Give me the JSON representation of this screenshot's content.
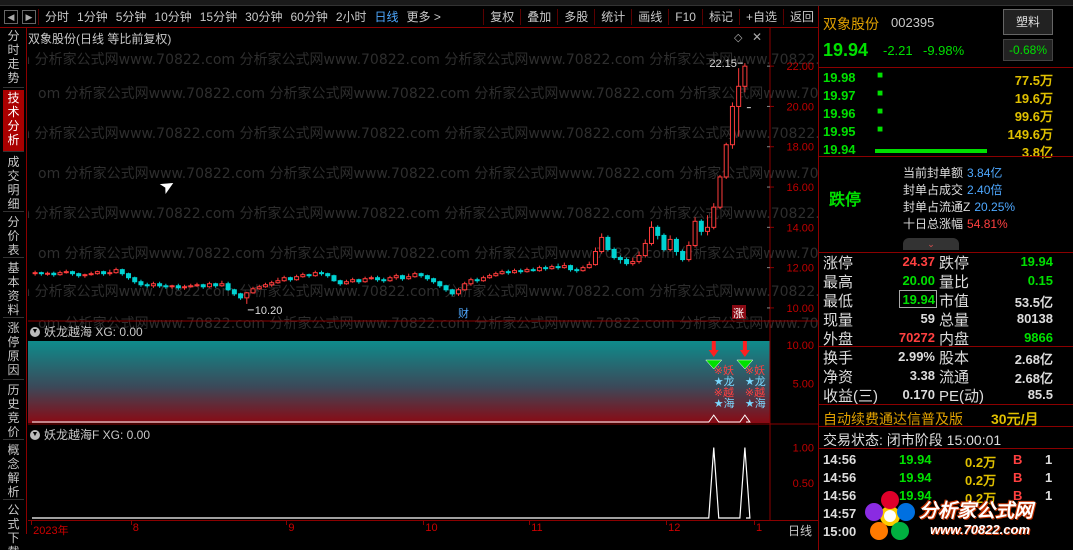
{
  "toolbar": {
    "periods": [
      "分时",
      "1分钟",
      "5分钟",
      "10分钟",
      "15分钟",
      "30分钟",
      "60分钟",
      "2小时",
      "日线",
      "更多 >"
    ],
    "active_period": "日线",
    "actions": [
      "复权",
      "叠加",
      "多股",
      "统计",
      "画线",
      "F10",
      "标记",
      "+自选",
      "返回"
    ]
  },
  "left_tabs": [
    "分时走势",
    "技术分析",
    "成交明细",
    "分价表",
    "基本资料",
    "涨停原因",
    "历史竞价",
    "概念解析",
    "公式下载"
  ],
  "left_tab_active": "技术分析",
  "main_chart": {
    "title": "双象股份(日线 等比前复权)",
    "y_ticks": [
      "22.00",
      "20.00",
      "18.00",
      "16.00",
      "14.00",
      "12.00",
      "10.00"
    ],
    "y_range": [
      9.5,
      23.0
    ],
    "high_label": "22.15",
    "low_label": "10.20",
    "marker_cai": "财",
    "marker_zhang": "涨",
    "watermark": "om 分析家公式网www.70822.com 分析家公式网www.70822.com 分析家公式网www.70822.com 分析家公式网www.70822.com",
    "candles": [
      [
        11.7,
        11.75,
        11.6,
        11.85
      ],
      [
        11.75,
        11.7,
        11.6,
        11.8
      ],
      [
        11.7,
        11.72,
        11.6,
        11.8
      ],
      [
        11.72,
        11.65,
        11.55,
        11.8
      ],
      [
        11.65,
        11.75,
        11.6,
        11.85
      ],
      [
        11.75,
        11.8,
        11.7,
        11.9
      ],
      [
        11.8,
        11.7,
        11.6,
        11.85
      ],
      [
        11.7,
        11.6,
        11.5,
        11.75
      ],
      [
        11.6,
        11.65,
        11.5,
        11.7
      ],
      [
        11.65,
        11.7,
        11.6,
        11.8
      ],
      [
        11.7,
        11.8,
        11.65,
        11.85
      ],
      [
        11.8,
        11.7,
        11.6,
        11.85
      ],
      [
        11.7,
        11.75,
        11.6,
        11.9
      ],
      [
        11.75,
        11.9,
        11.7,
        12.0
      ],
      [
        11.9,
        11.7,
        11.6,
        11.95
      ],
      [
        11.7,
        11.5,
        11.4,
        11.75
      ],
      [
        11.5,
        11.3,
        11.2,
        11.55
      ],
      [
        11.3,
        11.15,
        11.05,
        11.4
      ],
      [
        11.15,
        11.1,
        11.0,
        11.25
      ],
      [
        11.1,
        11.2,
        11.0,
        11.3
      ],
      [
        11.2,
        11.1,
        11.0,
        11.3
      ],
      [
        11.1,
        11.05,
        10.95,
        11.2
      ],
      [
        11.05,
        11.1,
        10.95,
        11.15
      ],
      [
        11.1,
        11.0,
        10.9,
        11.2
      ],
      [
        11.0,
        11.05,
        10.9,
        11.15
      ],
      [
        11.05,
        11.1,
        11.0,
        11.2
      ],
      [
        11.1,
        11.15,
        11.05,
        11.25
      ],
      [
        11.15,
        11.05,
        10.95,
        11.2
      ],
      [
        11.05,
        11.2,
        11.0,
        11.3
      ],
      [
        11.2,
        11.1,
        11.0,
        11.25
      ],
      [
        11.1,
        11.2,
        11.05,
        11.35
      ],
      [
        11.2,
        10.9,
        10.85,
        11.3
      ],
      [
        10.9,
        10.7,
        10.6,
        10.95
      ],
      [
        10.7,
        10.5,
        10.4,
        10.75
      ],
      [
        10.5,
        10.75,
        10.2,
        10.8
      ],
      [
        10.75,
        10.95,
        10.7,
        11.05
      ],
      [
        10.95,
        11.05,
        10.9,
        11.15
      ],
      [
        11.05,
        11.15,
        11.0,
        11.25
      ],
      [
        11.15,
        11.25,
        11.05,
        11.35
      ],
      [
        11.25,
        11.35,
        11.2,
        11.5
      ],
      [
        11.35,
        11.5,
        11.3,
        11.6
      ],
      [
        11.5,
        11.4,
        11.3,
        11.55
      ],
      [
        11.4,
        11.55,
        11.35,
        11.65
      ],
      [
        11.55,
        11.65,
        11.5,
        11.75
      ],
      [
        11.65,
        11.6,
        11.5,
        11.7
      ],
      [
        11.6,
        11.75,
        11.55,
        11.85
      ],
      [
        11.75,
        11.7,
        11.6,
        11.85
      ],
      [
        11.7,
        11.6,
        11.5,
        11.75
      ],
      [
        11.6,
        11.35,
        11.3,
        11.65
      ],
      [
        11.35,
        11.2,
        11.1,
        11.4
      ],
      [
        11.2,
        11.3,
        11.15,
        11.4
      ],
      [
        11.3,
        11.4,
        11.25,
        11.5
      ],
      [
        11.4,
        11.3,
        11.2,
        11.45
      ],
      [
        11.3,
        11.45,
        11.25,
        11.55
      ],
      [
        11.45,
        11.5,
        11.4,
        11.6
      ],
      [
        11.5,
        11.4,
        11.3,
        11.6
      ],
      [
        11.4,
        11.35,
        11.25,
        11.5
      ],
      [
        11.35,
        11.5,
        11.3,
        11.6
      ],
      [
        11.5,
        11.6,
        11.4,
        11.7
      ],
      [
        11.6,
        11.45,
        11.35,
        11.65
      ],
      [
        11.45,
        11.55,
        11.4,
        11.7
      ],
      [
        11.55,
        11.7,
        11.5,
        11.8
      ],
      [
        11.7,
        11.6,
        11.5,
        11.75
      ],
      [
        11.6,
        11.45,
        11.35,
        11.65
      ],
      [
        11.45,
        11.3,
        11.2,
        11.5
      ],
      [
        11.3,
        11.1,
        11.0,
        11.35
      ],
      [
        11.1,
        10.9,
        10.8,
        11.15
      ],
      [
        10.9,
        10.7,
        10.6,
        10.95
      ],
      [
        10.7,
        10.9,
        10.6,
        11.0
      ],
      [
        10.9,
        11.2,
        10.85,
        11.3
      ],
      [
        11.2,
        11.4,
        11.1,
        11.5
      ],
      [
        11.4,
        11.35,
        11.25,
        11.5
      ],
      [
        11.35,
        11.5,
        11.3,
        11.6
      ],
      [
        11.5,
        11.6,
        11.45,
        11.7
      ],
      [
        11.6,
        11.7,
        11.55,
        11.8
      ],
      [
        11.7,
        11.8,
        11.65,
        11.9
      ],
      [
        11.8,
        11.75,
        11.65,
        11.9
      ],
      [
        11.75,
        11.85,
        11.7,
        11.95
      ],
      [
        11.85,
        11.8,
        11.7,
        11.95
      ],
      [
        11.8,
        11.9,
        11.75,
        12.0
      ],
      [
        11.9,
        11.85,
        11.8,
        12.0
      ],
      [
        11.85,
        12.0,
        11.8,
        12.1
      ],
      [
        12.0,
        11.95,
        11.85,
        12.1
      ],
      [
        11.95,
        12.05,
        11.9,
        12.15
      ],
      [
        12.05,
        12.0,
        11.9,
        12.2
      ],
      [
        12.0,
        12.1,
        11.95,
        12.25
      ],
      [
        12.1,
        11.9,
        11.8,
        12.15
      ],
      [
        11.9,
        11.85,
        11.75,
        12.0
      ],
      [
        11.85,
        12.0,
        11.8,
        12.1
      ],
      [
        12.0,
        12.15,
        11.95,
        12.3
      ],
      [
        12.15,
        12.8,
        12.1,
        13.0
      ],
      [
        12.8,
        13.5,
        12.7,
        13.7
      ],
      [
        13.5,
        12.9,
        12.8,
        13.6
      ],
      [
        12.9,
        12.5,
        12.4,
        13.0
      ],
      [
        12.5,
        12.4,
        12.2,
        12.6
      ],
      [
        12.4,
        12.2,
        12.1,
        12.5
      ],
      [
        12.2,
        12.3,
        12.1,
        12.5
      ],
      [
        12.3,
        12.6,
        12.2,
        12.8
      ],
      [
        12.6,
        13.2,
        12.5,
        13.4
      ],
      [
        13.2,
        14.0,
        13.1,
        14.3
      ],
      [
        14.0,
        13.6,
        13.4,
        14.1
      ],
      [
        13.6,
        12.9,
        12.8,
        13.7
      ],
      [
        12.9,
        13.4,
        12.8,
        13.6
      ],
      [
        13.4,
        12.8,
        12.6,
        13.5
      ],
      [
        12.8,
        12.4,
        12.3,
        12.9
      ],
      [
        12.4,
        13.1,
        12.3,
        13.3
      ],
      [
        13.1,
        14.3,
        13.0,
        14.5
      ],
      [
        14.3,
        13.8,
        13.6,
        14.4
      ],
      [
        13.8,
        14.0,
        13.6,
        14.6
      ],
      [
        14.0,
        15.0,
        13.9,
        15.2
      ],
      [
        15.0,
        16.5,
        14.9,
        16.6
      ],
      [
        16.5,
        18.1,
        16.4,
        18.2
      ],
      [
        18.1,
        20.0,
        17.9,
        20.2
      ],
      [
        20.0,
        21.0,
        18.5,
        21.9
      ],
      [
        21.0,
        22.0,
        20.7,
        22.15
      ]
    ],
    "bid_price": 19.94
  },
  "indicator1": {
    "title": "妖龙越海 XG: 0.00",
    "y_ticks": [
      "10.00",
      "5.00"
    ],
    "y_range": [
      0,
      10.5
    ],
    "signals": [
      {
        "index": 109,
        "lines": [
          "※妖",
          "★龙",
          "※越",
          "★海"
        ]
      },
      {
        "index": 114,
        "lines": [
          "※妖",
          "★龙",
          "※越",
          "★海"
        ]
      }
    ]
  },
  "indicator2": {
    "title": "妖龙越海F XG: 0.00",
    "y_ticks": [
      "1.00",
      "0.50"
    ],
    "y_range": [
      0,
      1.05
    ],
    "spikes": [
      109,
      114
    ]
  },
  "date_axis": {
    "labels": [
      {
        "text": "2023年",
        "index": 0
      },
      {
        "text": "8",
        "index": 16
      },
      {
        "text": "9",
        "index": 41
      },
      {
        "text": "10",
        "index": 63
      },
      {
        "text": "11",
        "index": 80
      },
      {
        "text": "12",
        "index": 102
      },
      {
        "text": "1",
        "index": 120
      }
    ],
    "period_label": "日线"
  },
  "quote": {
    "name": "双象股份",
    "code": "002395",
    "sector": "塑料",
    "price": "19.94",
    "change": "-2.21",
    "change_pct": "-9.98%",
    "sector_change": "-0.68%",
    "bids": [
      {
        "price": "19.98",
        "vol": "77.5万"
      },
      {
        "price": "19.97",
        "vol": "19.6万"
      },
      {
        "price": "19.96",
        "vol": "99.6万"
      },
      {
        "price": "19.95",
        "vol": "149.6万"
      },
      {
        "price": "19.94",
        "vol": "3.8亿"
      }
    ],
    "limit_status": "跌停",
    "seal": [
      {
        "label": "当前封单额",
        "value": "3.84亿",
        "color": "#4ea8ff"
      },
      {
        "label": "封单占成交",
        "value": "2.40倍",
        "color": "#4ea8ff"
      },
      {
        "label": "封单占流通Z",
        "value": "20.25%",
        "color": "#4ea8ff"
      },
      {
        "label": "十日总涨幅",
        "value": "54.81%",
        "color": "#ff4040"
      }
    ],
    "stats": [
      {
        "k1": "涨停",
        "v1": "24.37",
        "c1": "red",
        "k2": "跌停",
        "v2": "19.94",
        "c2": "green"
      },
      {
        "k1": "最高",
        "v1": "20.00",
        "c1": "green",
        "k2": "量比",
        "v2": "0.15",
        "c2": "green"
      },
      {
        "k1": "最低",
        "v1": "19.94",
        "c1": "green",
        "k2": "市值",
        "v2": "53.5亿",
        "c2": "white"
      },
      {
        "k1": "现量",
        "v1": "59",
        "c1": "white",
        "k2": "总量",
        "v2": "80138",
        "c2": "white"
      },
      {
        "k1": "外盘",
        "v1": "70272",
        "c1": "red",
        "k2": "内盘",
        "v2": "9866",
        "c2": "green"
      },
      {
        "k1": "换手",
        "v1": "2.99%",
        "c1": "white",
        "k2": "股本",
        "v2": "2.68亿",
        "c2": "white"
      },
      {
        "k1": "净资",
        "v1": "3.38",
        "c1": "white",
        "k2": "流通",
        "v2": "2.68亿",
        "c2": "white"
      },
      {
        "k1": "收益(三)",
        "v1": "0.170",
        "c1": "white",
        "k2": "PE(动)",
        "v2": "85.5",
        "c2": "white"
      }
    ],
    "ad": "自动续费通达信普及版",
    "ad_price": "30元/月",
    "status": "交易状态: 闭市阶段 15:00:01",
    "ticks": [
      {
        "t": "14:56",
        "p": "19.94",
        "v": "0.2万",
        "b": "B",
        "n": "1"
      },
      {
        "t": "14:56",
        "p": "19.94",
        "v": "0.2万",
        "b": "B",
        "n": "1"
      },
      {
        "t": "14:56",
        "p": "19.94",
        "v": "0.2万",
        "b": "B",
        "n": "1"
      },
      {
        "t": "14:57",
        "p": "",
        "v": "",
        "b": "",
        "n": ""
      },
      {
        "t": "15:00",
        "p": "",
        "v": "",
        "b": "",
        "n": ""
      }
    ]
  },
  "logo": {
    "text": "分析家公式网",
    "url": "www.70822.com"
  },
  "colors": {
    "up": "#ff3c3c",
    "down": "#00d2d2",
    "frame": "#8b0000",
    "signal_green": "#00e000"
  }
}
